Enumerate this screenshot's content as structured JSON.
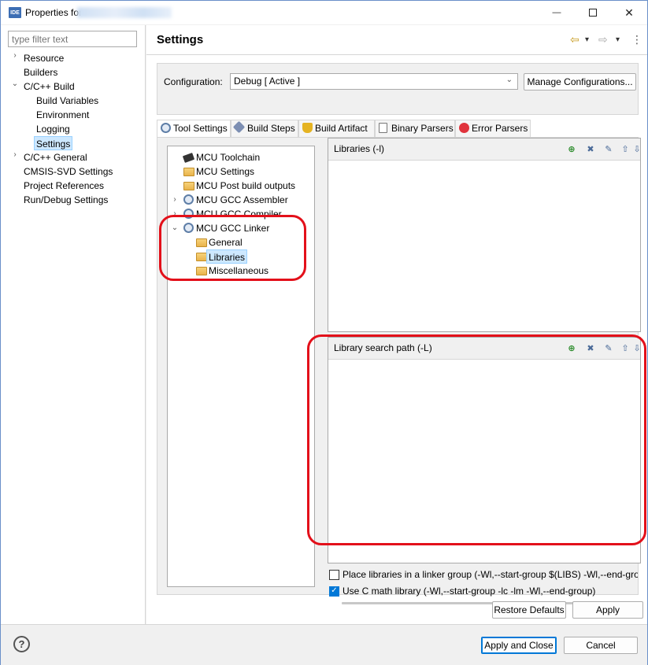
{
  "window": {
    "title": "Properties for",
    "icon": "ide-icon",
    "controls": {
      "minimize": "—",
      "close": "✕"
    }
  },
  "sidebar": {
    "filter_placeholder": "type filter text",
    "items": [
      {
        "label": "Resource",
        "level": 0,
        "twisty": "›"
      },
      {
        "label": "Builders",
        "level": 0,
        "twisty": ""
      },
      {
        "label": "C/C++ Build",
        "level": 0,
        "twisty": "⌄"
      },
      {
        "label": "Build Variables",
        "level": 1,
        "twisty": ""
      },
      {
        "label": "Environment",
        "level": 1,
        "twisty": ""
      },
      {
        "label": "Logging",
        "level": 1,
        "twisty": ""
      },
      {
        "label": "Settings",
        "level": 1,
        "twisty": "",
        "selected": true
      },
      {
        "label": "C/C++ General",
        "level": 0,
        "twisty": "›"
      },
      {
        "label": "CMSIS-SVD Settings",
        "level": 0,
        "twisty": ""
      },
      {
        "label": "Project References",
        "level": 0,
        "twisty": ""
      },
      {
        "label": "Run/Debug Settings",
        "level": 0,
        "twisty": ""
      }
    ]
  },
  "header": {
    "title": "Settings",
    "back_arrow": "⇦",
    "forward_arrow": "⇨",
    "dropdown": "▾",
    "menu": "⋮"
  },
  "configuration": {
    "label": "Configuration:",
    "value": "Debug  [ Active ]",
    "manage_button": "Manage Configurations..."
  },
  "tabs": [
    {
      "label": "Tool Settings",
      "active": true,
      "icon": "gear-icon"
    },
    {
      "label": "Build Steps",
      "active": false,
      "icon": "build-steps-icon"
    },
    {
      "label": "Build Artifact",
      "active": false,
      "icon": "trophy-icon"
    },
    {
      "label": "Binary Parsers",
      "active": false,
      "icon": "binary-icon"
    },
    {
      "label": "Error Parsers",
      "active": false,
      "icon": "error-icon"
    }
  ],
  "tool_tree": [
    {
      "label": "MCU Toolchain",
      "icon": "chip-icon",
      "twisty": ""
    },
    {
      "label": "MCU Settings",
      "icon": "folder-icon",
      "twisty": ""
    },
    {
      "label": "MCU Post build outputs",
      "icon": "folder-icon",
      "twisty": ""
    },
    {
      "label": "MCU GCC Assembler",
      "icon": "gear-icon",
      "twisty": "›"
    },
    {
      "label": "MCU GCC Compiler",
      "icon": "gear-icon",
      "twisty": "›"
    },
    {
      "label": "MCU GCC Linker",
      "icon": "gear-icon",
      "twisty": "⌄"
    },
    {
      "label": "General",
      "icon": "folder-icon",
      "twisty": ""
    },
    {
      "label": "Libraries",
      "icon": "folder-icon",
      "twisty": "",
      "selected": true
    },
    {
      "label": "Miscellaneous",
      "icon": "folder-icon",
      "twisty": ""
    }
  ],
  "libraries_pane": {
    "label": "Libraries (-l)"
  },
  "search_path_pane": {
    "label": "Library search path (-L)"
  },
  "options": [
    {
      "label": "Place libraries in a linker group (-Wl,--start-group $(LIBS) -Wl,--end-grou",
      "checked": false
    },
    {
      "label": "Use C math library (-Wl,--start-group -lc -lm -Wl,--end-group)",
      "checked": true
    }
  ],
  "buttons": {
    "restore_defaults": "Restore Defaults",
    "apply": "Apply",
    "apply_and_close": "Apply and Close",
    "cancel": "Cancel",
    "help": "?"
  },
  "colors": {
    "annotation": "#e3101a",
    "selection": "#cde8ff",
    "accent": "#0078d7"
  }
}
